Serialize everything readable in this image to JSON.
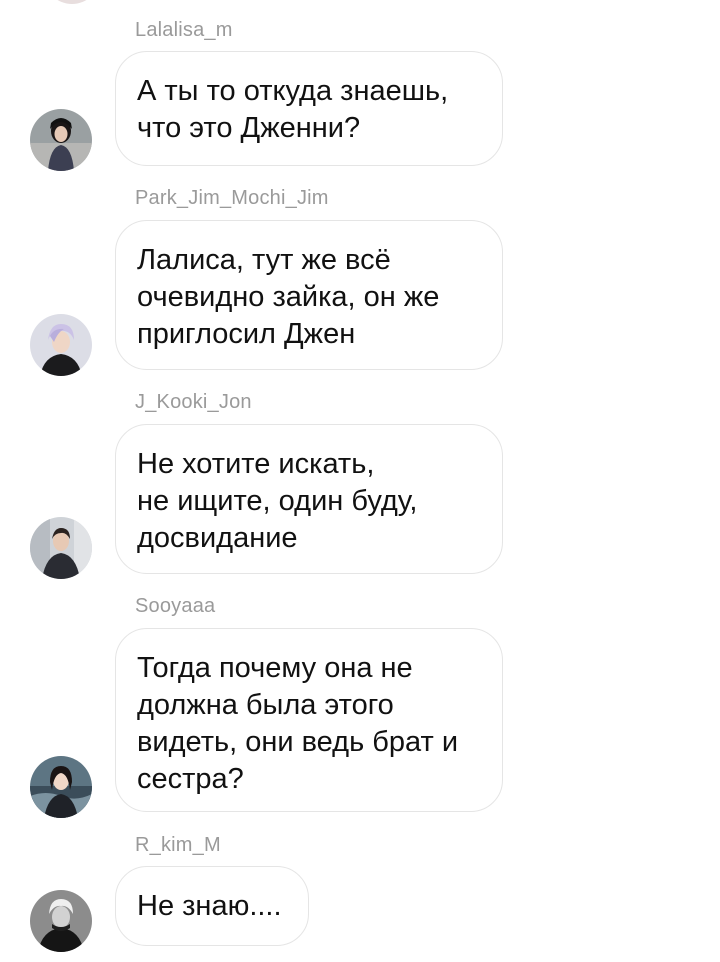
{
  "messages": [
    {
      "sender": "Lalalisa_m",
      "text": "А ты то откуда знаешь,\nчто это Дженни?"
    },
    {
      "sender": "Park_Jim_Mochi_Jim",
      "text": "Лалиса, тут же всё\nочевидно зайка, он же\nприглосил Джен"
    },
    {
      "sender": "J_Kooki_Jon",
      "text": "Не хотите искать,\nне ищите, один буду,\nдосвидание"
    },
    {
      "sender": "Sooyaaa",
      "text": "Тогда почему она не\nдолжна была этого\nвидеть, они ведь брат и\nсестра?"
    },
    {
      "sender": "R_kim_M",
      "text": "Не знаю...."
    }
  ]
}
